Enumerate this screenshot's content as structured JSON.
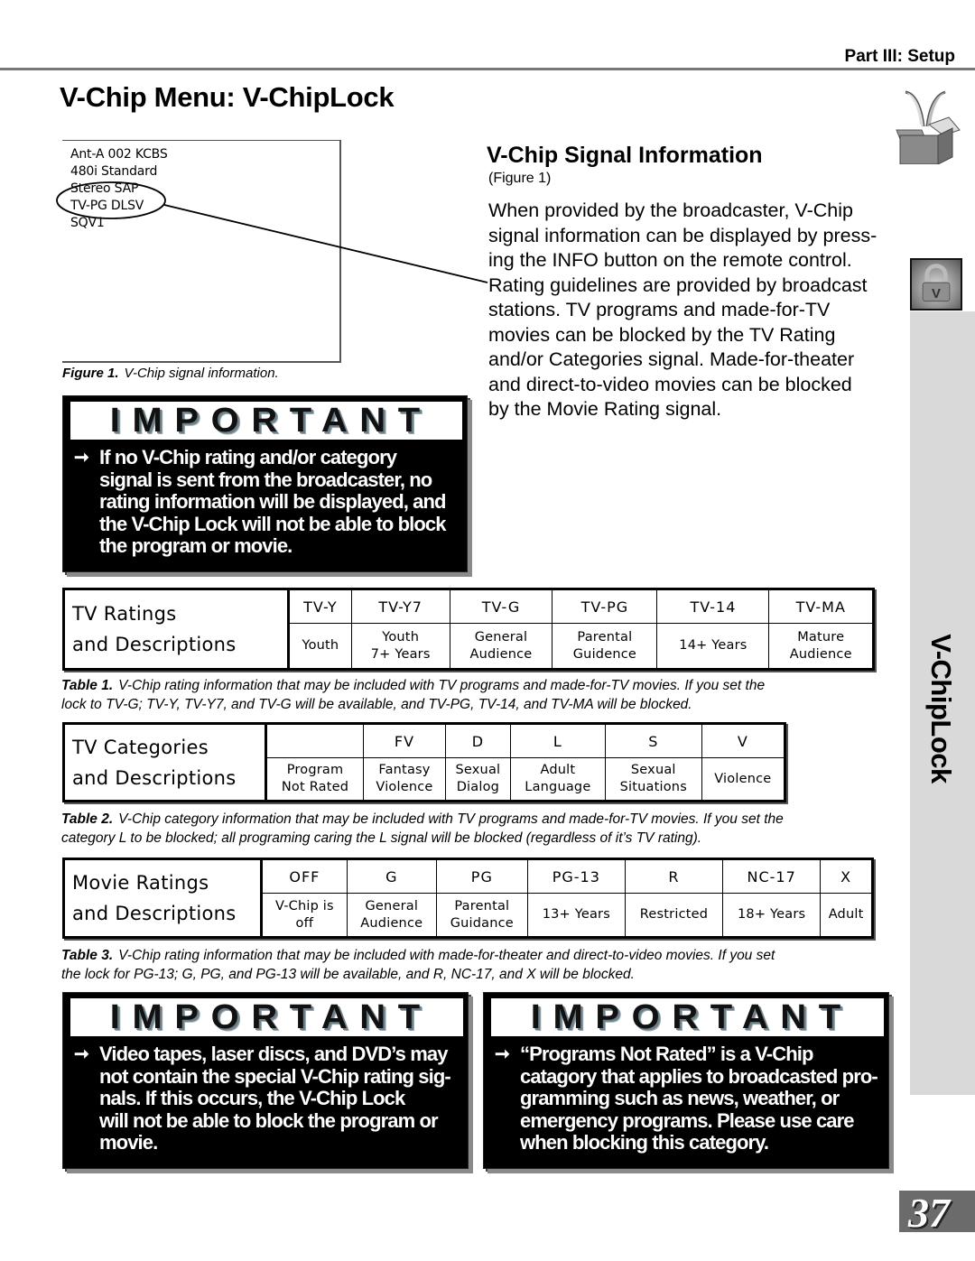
{
  "header": {
    "part_label": "Part III: Setup",
    "page_title": "V-Chip Menu: V-ChipLock"
  },
  "figure1": {
    "screen_lines": [
      "Ant-A 002 KCBS",
      "480i Standard",
      "Stereo SAP",
      "TV-PG DLSV",
      "SQV1"
    ],
    "highlighted_line": "TV-PG DLSV",
    "caption_label": "Figure 1.",
    "caption_text": "V-Chip signal information."
  },
  "signal_info": {
    "title": "V-Chip Signal Information",
    "figure_ref": "(Figure 1)",
    "body_lines": [
      "When provided by the broadcaster, V-Chip",
      "signal information can be displayed by press-",
      "ing the INFO button on the remote control.",
      "Rating guidelines are provided by broadcast",
      "stations.  TV programs and made-for-TV",
      "movies can be blocked by the TV Rating",
      "and/or Categories signal.  Made-for-theater",
      "and direct-to-video movies can be blocked",
      "by the Movie Rating signal."
    ]
  },
  "important_boxes": [
    {
      "heading": "IMPORTANT",
      "arrow": "➞",
      "lines": [
        "If no V-Chip rating and/or category",
        "signal is sent from the broadcaster, no",
        "rating information will be displayed, and",
        "the V-Chip Lock will not be able to block",
        "the program or movie."
      ]
    },
    {
      "heading": "IMPORTANT",
      "arrow": "➞",
      "lines": [
        "Video tapes, laser discs, and DVD’s may",
        "not contain the special V-Chip rating sig-",
        "nals.  If this occurs, the V-Chip Lock",
        "will not be able to block the program or",
        "movie."
      ]
    },
    {
      "heading": "IMPORTANT",
      "arrow": "➞",
      "lines": [
        "“Programs Not Rated” is a V-Chip",
        "catagory that applies to broadcasted pro-",
        "gramming such as news, weather, or",
        "emergency programs.  Please use care",
        "when blocking this category."
      ]
    }
  ],
  "tables": [
    {
      "header_line1": "TV Ratings",
      "header_line2": "and Descriptions",
      "columns": [
        {
          "code": "TV-Y",
          "desc": [
            "Youth"
          ]
        },
        {
          "code": "TV-Y7",
          "desc": [
            "Youth",
            "7+ Years"
          ]
        },
        {
          "code": "TV-G",
          "desc": [
            "General",
            "Audience"
          ]
        },
        {
          "code": "TV-PG",
          "desc": [
            "Parental",
            "Guidence"
          ]
        },
        {
          "code": "TV-14",
          "desc": [
            "14+ Years"
          ]
        },
        {
          "code": "TV-MA",
          "desc": [
            "Mature",
            "Audience"
          ]
        }
      ],
      "caption_label": "Table 1.",
      "caption_lines": [
        "V-Chip rating information that may be included with TV programs and made-for-TV movies.  If you set the",
        "lock to TV-G; TV-Y, TV-Y7, and TV-G will be available, and TV-PG, TV-14, and TV-MA will be blocked."
      ]
    },
    {
      "header_line1": "TV Categories",
      "header_line2": "and Descriptions",
      "columns": [
        {
          "code": "",
          "desc": [
            "Program",
            "Not Rated"
          ]
        },
        {
          "code": "FV",
          "desc": [
            "Fantasy",
            "Violence"
          ]
        },
        {
          "code": "D",
          "desc": [
            "Sexual",
            "Dialog"
          ]
        },
        {
          "code": "L",
          "desc": [
            "Adult",
            "Language"
          ]
        },
        {
          "code": "S",
          "desc": [
            "Sexual",
            "Situations"
          ]
        },
        {
          "code": "V",
          "desc": [
            "Violence"
          ]
        }
      ],
      "caption_label": "Table 2.",
      "caption_lines": [
        "V-Chip category information that may be included with TV programs and made-for-TV movies.  If you set the",
        "category L to be blocked; all programing caring the L signal will be blocked (regardless of it’s TV rating)."
      ]
    },
    {
      "header_line1": "Movie Ratings",
      "header_line2": "and Descriptions",
      "columns": [
        {
          "code": "OFF",
          "desc": [
            "V-Chip is",
            "off"
          ]
        },
        {
          "code": "G",
          "desc": [
            "General",
            "Audience"
          ]
        },
        {
          "code": "PG",
          "desc": [
            "Parental",
            "Guidance"
          ]
        },
        {
          "code": "PG-13",
          "desc": [
            "13+ Years"
          ]
        },
        {
          "code": "R",
          "desc": [
            "Restricted"
          ]
        },
        {
          "code": "NC-17",
          "desc": [
            "18+ Years"
          ]
        },
        {
          "code": "X",
          "desc": [
            "Adult"
          ]
        }
      ],
      "caption_label": "Table 3.",
      "caption_lines": [
        "V-Chip rating information that may be included with made-for-theater and direct-to-video movies.  If you set",
        "the lock for PG-13; G, PG, and PG-13 will be available, and R, NC-17, and X will be blocked."
      ]
    }
  ],
  "side_tab": {
    "label": "V-ChipLock",
    "icons": [
      "open-box-icon",
      "padlock-v-icon"
    ]
  },
  "footer": {
    "page_number": "37"
  }
}
